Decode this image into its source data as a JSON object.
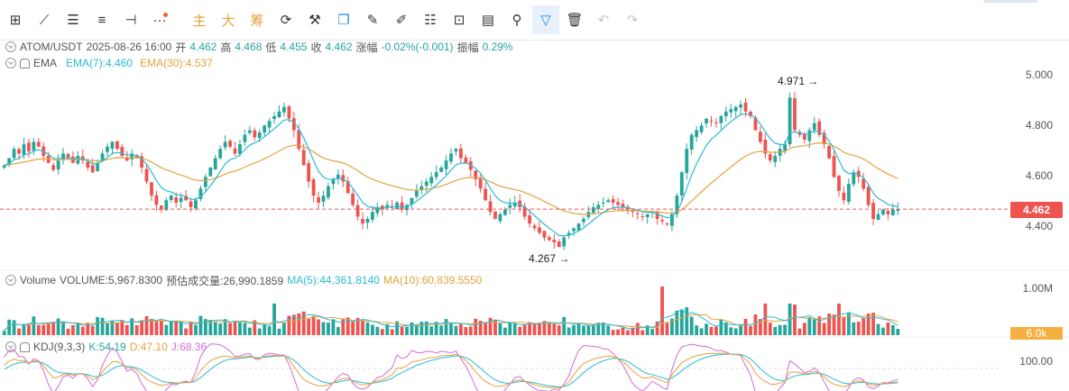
{
  "toolbar": {
    "items": [
      {
        "name": "crosshair-icon",
        "glyph": "⊞"
      },
      {
        "name": "trendline-icon",
        "glyph": "⟋"
      },
      {
        "name": "horizontal-lines-icon",
        "glyph": "☰"
      },
      {
        "name": "parallel-lines-icon",
        "glyph": "≡"
      },
      {
        "name": "segment-icon",
        "glyph": "⊣"
      },
      {
        "name": "more-icon",
        "glyph": "···"
      }
    ],
    "cn_buttons": [
      "主",
      "大",
      "筹"
    ],
    "tools": [
      {
        "name": "refresh-icon",
        "glyph": "⟳"
      },
      {
        "name": "tool-edit-icon",
        "glyph": "⚒"
      },
      {
        "name": "copy-icon",
        "glyph": "❐"
      },
      {
        "name": "pencil-icon",
        "glyph": "✎"
      },
      {
        "name": "ruler-icon",
        "glyph": "✐"
      },
      {
        "name": "candles-icon",
        "glyph": "☷"
      },
      {
        "name": "lock-icon",
        "glyph": "⊡"
      },
      {
        "name": "note-icon",
        "glyph": "▤"
      },
      {
        "name": "attach-icon",
        "glyph": "⚲"
      },
      {
        "name": "filter-icon",
        "glyph": "▽"
      },
      {
        "name": "trash-icon",
        "glyph": "🗑"
      },
      {
        "name": "undo-icon",
        "glyph": "↶"
      },
      {
        "name": "redo-icon",
        "glyph": "↷"
      }
    ]
  },
  "main_legend": {
    "symbol": "ATOM/USDT",
    "datetime": "2025-08-26 16:00",
    "open_label": "开",
    "open": "4.462",
    "high_label": "高",
    "high": "4.468",
    "low_label": "低",
    "low": "4.455",
    "close_label": "收",
    "close": "4.462",
    "change_label": "涨幅",
    "change": "-0.02%(-0.001)",
    "amplitude_label": "振幅",
    "amplitude": "0.29%"
  },
  "ema_legend": {
    "name": "EMA",
    "ema7": "EMA(7):4.460",
    "ema30": "EMA(30):4.537"
  },
  "volume_legend": {
    "name": "Volume",
    "volume": "VOLUME:5,967.8300",
    "est": "预估成交量:26,990.1859",
    "ma5": "MA(5):44,361.8140",
    "ma10": "MA(10):60,839.5550"
  },
  "kdj_legend": {
    "name": "KDJ(9,3,3)",
    "k": "K:54.19",
    "d": "D:47.10",
    "j": "J:68.36"
  },
  "price_axis": [
    "5.000",
    "4.800",
    "4.600",
    "4.400"
  ],
  "current_price": "4.462",
  "volume_axis": "1.00M",
  "volume_tag": "6.0k",
  "kdj_axis": "100.00",
  "annotations": {
    "high": "4.971 →",
    "low": "4.267 →"
  },
  "colors": {
    "up": "#26a69a",
    "down": "#ef5350",
    "ema7": "#2bbad6",
    "ema30": "#e6a23c",
    "k": "#e6a23c",
    "d": "#2bbad6",
    "j": "#d46bd6",
    "price_line": "#ef5350"
  },
  "chart_data": {
    "type": "candlestick",
    "symbol": "ATOM/USDT",
    "ylim": [
      4.2,
      5.08
    ],
    "close_series": [
      4.65,
      4.68,
      4.72,
      4.7,
      4.74,
      4.71,
      4.75,
      4.73,
      4.69,
      4.66,
      4.63,
      4.67,
      4.7,
      4.68,
      4.66,
      4.69,
      4.67,
      4.64,
      4.62,
      4.66,
      4.7,
      4.73,
      4.75,
      4.72,
      4.69,
      4.67,
      4.7,
      4.68,
      4.64,
      4.58,
      4.52,
      4.48,
      4.46,
      4.5,
      4.52,
      4.49,
      4.51,
      4.5,
      4.47,
      4.5,
      4.55,
      4.6,
      4.64,
      4.68,
      4.72,
      4.75,
      4.73,
      4.7,
      4.74,
      4.78,
      4.8,
      4.77,
      4.79,
      4.82,
      4.84,
      4.86,
      4.88,
      4.9,
      4.85,
      4.8,
      4.72,
      4.65,
      4.58,
      4.52,
      4.49,
      4.52,
      4.56,
      4.59,
      4.61,
      4.58,
      4.53,
      4.48,
      4.43,
      4.4,
      4.42,
      4.45,
      4.47,
      4.46,
      4.48,
      4.47,
      4.49,
      4.46,
      4.48,
      4.51,
      4.54,
      4.56,
      4.58,
      4.6,
      4.62,
      4.64,
      4.67,
      4.7,
      4.72,
      4.68,
      4.66,
      4.63,
      4.59,
      4.55,
      4.5,
      4.45,
      4.42,
      4.44,
      4.46,
      4.48,
      4.49,
      4.47,
      4.43,
      4.4,
      4.38,
      4.36,
      4.34,
      4.33,
      4.32,
      4.3,
      4.34,
      4.36,
      4.38,
      4.4,
      4.42,
      4.45,
      4.47,
      4.48,
      4.49,
      4.5,
      4.49,
      4.48,
      4.47,
      4.46,
      4.45,
      4.44,
      4.43,
      4.44,
      4.45,
      4.42,
      4.41,
      4.4,
      4.44,
      4.52,
      4.62,
      4.72,
      4.78,
      4.8,
      4.82,
      4.85,
      4.84,
      4.83,
      4.86,
      4.88,
      4.89,
      4.9,
      4.91,
      4.88,
      4.86,
      4.8,
      4.75,
      4.7,
      4.67,
      4.69,
      4.72,
      4.74,
      4.94,
      4.8,
      4.78,
      4.76,
      4.8,
      4.83,
      4.78,
      4.74,
      4.68,
      4.6,
      4.54,
      4.5,
      4.57,
      4.62,
      4.6,
      4.55,
      4.48,
      4.42,
      4.44,
      4.46,
      4.44,
      4.46,
      4.462
    ]
  }
}
